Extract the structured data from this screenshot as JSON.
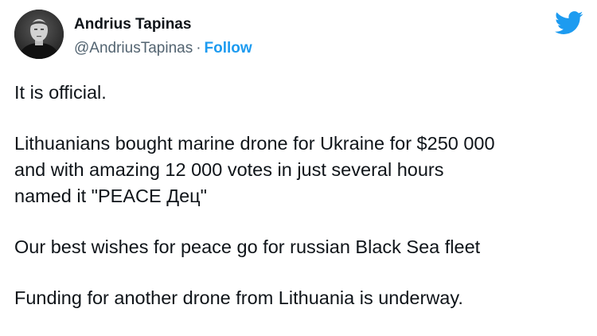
{
  "author": {
    "name": "Andrius Tapinas",
    "handle": "@AndriusTapinas",
    "separator": "·",
    "follow_label": "Follow"
  },
  "icons": {
    "avatar": "profile-photo",
    "logo": "twitter-bird-icon"
  },
  "colors": {
    "accent": "#1d9bf0",
    "text": "#0f1419",
    "muted": "#536471"
  },
  "tweet": {
    "paragraphs": [
      "It is official.",
      "Lithuanians bought marine drone for Ukraine for $250 000\nand with amazing 12 000 votes in just several hours\nnamed it \"PEACE Дец\"",
      "Our best wishes for peace go for russian Black Sea fleet",
      "Funding for another drone from Lithuania is underway."
    ]
  }
}
